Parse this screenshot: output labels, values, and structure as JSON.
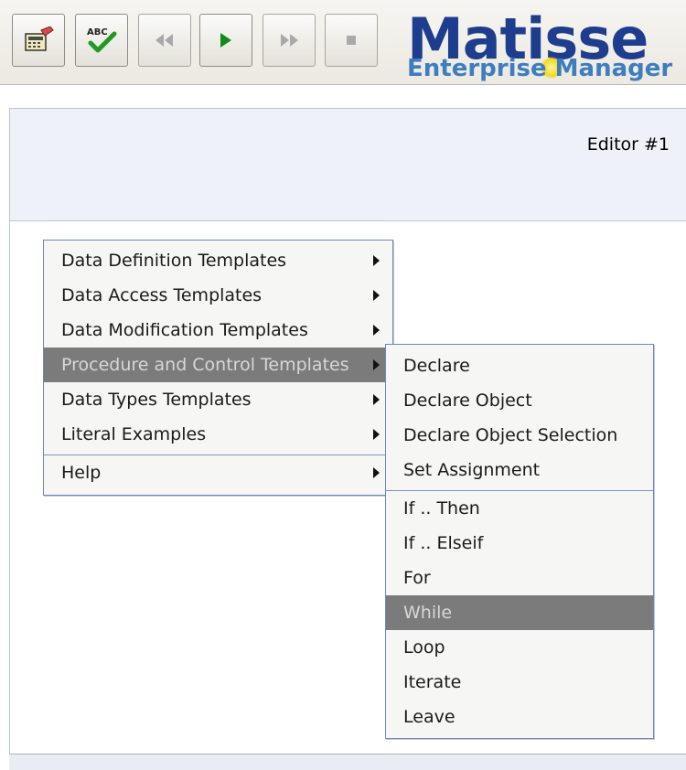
{
  "toolbar": {
    "buttons": [
      {
        "name": "calculator-icon",
        "enabled": true
      },
      {
        "name": "spellcheck-icon",
        "label": "ABC",
        "enabled": true
      },
      {
        "name": "rewind-icon",
        "enabled": false
      },
      {
        "name": "play-icon",
        "enabled": true
      },
      {
        "name": "fast-forward-icon",
        "enabled": false
      },
      {
        "name": "stop-icon",
        "enabled": false
      }
    ]
  },
  "logo": {
    "title": "Matisse",
    "subtitle": "Enterprise Manager"
  },
  "editor": {
    "label": "Editor #1"
  },
  "context_menu": {
    "items": [
      {
        "label": "Data Definition Templates",
        "submenu": true
      },
      {
        "label": "Data Access Templates",
        "submenu": true
      },
      {
        "label": "Data Modification Templates",
        "submenu": true
      },
      {
        "label": "Procedure and Control Templates",
        "submenu": true,
        "active": true
      },
      {
        "label": "Data Types Templates",
        "submenu": true
      },
      {
        "label": "Literal Examples",
        "submenu": true
      },
      {
        "label": "Help",
        "submenu": true
      }
    ]
  },
  "submenu": {
    "items": [
      {
        "label": "Declare"
      },
      {
        "label": "Declare Object"
      },
      {
        "label": "Declare Object Selection"
      },
      {
        "label": "Set Assignment"
      },
      {
        "label": "If .. Then"
      },
      {
        "label": "If .. Elseif"
      },
      {
        "label": "For"
      },
      {
        "label": "While",
        "active": true
      },
      {
        "label": "Loop"
      },
      {
        "label": "Iterate"
      },
      {
        "label": "Leave"
      }
    ]
  },
  "colors": {
    "menu_highlight": "#7b7b7b",
    "menu_border": "#6c86bd",
    "logo_primary": "#1f3d8f",
    "logo_secondary": "#3e7dbf",
    "play_green": "#138a1d"
  }
}
